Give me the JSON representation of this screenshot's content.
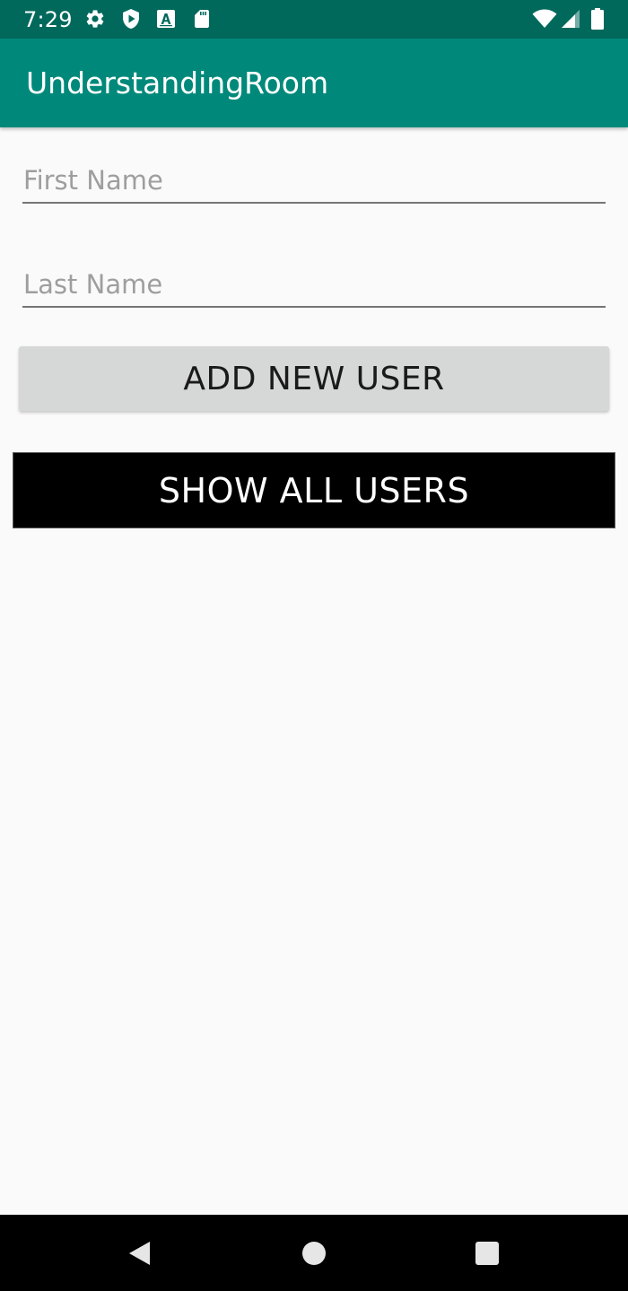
{
  "status_bar": {
    "time": "7:29",
    "icons": [
      "gear-icon",
      "shield-play-icon",
      "font-a-icon",
      "sd-card-icon",
      "wifi-icon",
      "signal-icon",
      "battery-icon"
    ]
  },
  "app_bar": {
    "title": "UnderstandingRoom"
  },
  "form": {
    "first_name": {
      "value": "",
      "placeholder": "First Name"
    },
    "last_name": {
      "value": "",
      "placeholder": "Last Name"
    }
  },
  "buttons": {
    "add_user": "ADD NEW USER",
    "show_users": "SHOW ALL USERS"
  },
  "nav_bar": {
    "icons": [
      "back-icon",
      "home-icon",
      "recents-icon"
    ]
  },
  "colors": {
    "status_bar": "#00695c",
    "app_bar": "#00897b",
    "background": "#fafafa",
    "add_button": "#d6d7d7",
    "show_button": "#000000"
  }
}
